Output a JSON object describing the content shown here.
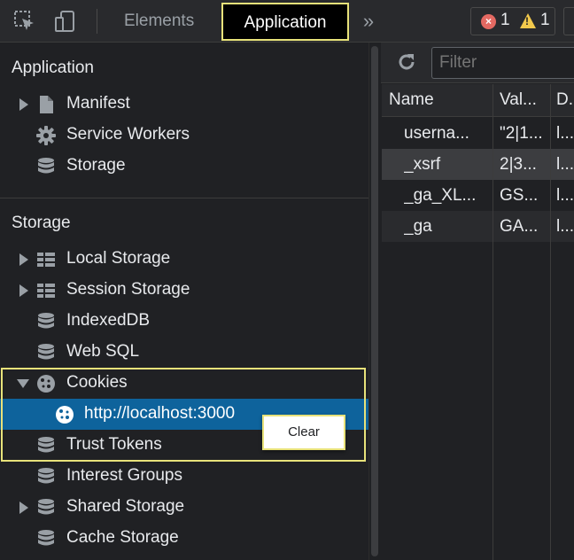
{
  "toolbar": {
    "tabs": [
      {
        "label": "Elements"
      },
      {
        "label": "Application"
      }
    ],
    "more_label": "»",
    "errors": "1",
    "warnings": "1"
  },
  "sidebar": {
    "application_section": {
      "title": "Application",
      "items": [
        {
          "label": "Manifest",
          "icon": "file-icon",
          "expandable": true
        },
        {
          "label": "Service Workers",
          "icon": "gear-icon",
          "expandable": false
        },
        {
          "label": "Storage",
          "icon": "database-icon",
          "expandable": false
        }
      ]
    },
    "storage_section": {
      "title": "Storage",
      "items": [
        {
          "label": "Local Storage",
          "icon": "table-icon",
          "expandable": true
        },
        {
          "label": "Session Storage",
          "icon": "table-icon",
          "expandable": true
        },
        {
          "label": "IndexedDB",
          "icon": "database-icon",
          "expandable": false
        },
        {
          "label": "Web SQL",
          "icon": "database-icon",
          "expandable": false
        },
        {
          "label": "Cookies",
          "icon": "cookie-icon",
          "expanded": true
        },
        {
          "label": "http://localhost:3000",
          "icon": "cookie-icon",
          "selected": true
        },
        {
          "label": "Trust Tokens",
          "icon": "database-icon",
          "expandable": false
        },
        {
          "label": "Interest Groups",
          "icon": "database-icon",
          "expandable": false
        },
        {
          "label": "Shared Storage",
          "icon": "database-icon",
          "expandable": true
        },
        {
          "label": "Cache Storage",
          "icon": "database-icon",
          "expandable": false
        }
      ]
    },
    "context_menu": {
      "items": [
        "Clear"
      ]
    }
  },
  "cookies_table": {
    "filter_placeholder": "Filter",
    "columns": [
      "Name",
      "Val...",
      "D..."
    ],
    "rows": [
      [
        "userna...",
        "\"2|1...",
        "l..."
      ],
      [
        "_xsrf",
        "2|3...",
        "l..."
      ],
      [
        "_ga_XL...",
        "GS...",
        "l..."
      ],
      [
        "_ga",
        "GA...",
        "l..."
      ]
    ]
  },
  "colors": {
    "accent_highlight": "#e8e27a",
    "selection": "#0e639c",
    "error": "#e46962",
    "warning": "#f2c94c"
  }
}
